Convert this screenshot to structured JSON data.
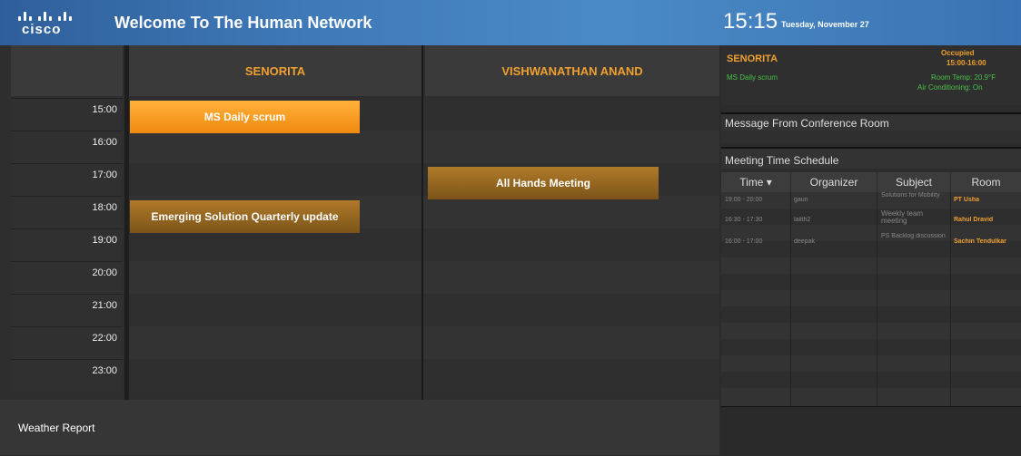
{
  "header": {
    "logo_text": "cisco",
    "title": "Welcome To The Human Network",
    "time": "15:15",
    "date": "Tuesday, November 27"
  },
  "schedule": {
    "rooms": [
      "SENORITA",
      "VISHWANATHAN ANAND"
    ],
    "hours": [
      "15:00",
      "16:00",
      "17:00",
      "18:00",
      "19:00",
      "20:00",
      "21:00",
      "22:00",
      "23:00"
    ],
    "events": [
      {
        "title": "MS Daily scrum",
        "room": "SENORITA",
        "start": "15:00",
        "end": "16:00"
      },
      {
        "title": "All Hands Meeting",
        "room": "VISHWANATHAN ANAND",
        "start": "17:00",
        "end": "18:00"
      },
      {
        "title": "Emerging Solution Quarterly update",
        "room": "SENORITA",
        "start": "18:00",
        "end": "19:00"
      }
    ],
    "weather_label": "Weather Report"
  },
  "status": {
    "room": "SENORITA",
    "state": "Occupied",
    "state_time": "15:00-16:00",
    "current_meeting": "MS Daily scrum",
    "room_temp": "Room Temp: 20.9°F",
    "air_conditioning": "Air Conditioning: On"
  },
  "messages": {
    "heading": "Message From Conference Room"
  },
  "meeting_schedule": {
    "heading": "Meeting Time Schedule",
    "columns": [
      "Time ▾",
      "Organizer",
      "Subject",
      "Room"
    ],
    "rows": [
      {
        "time": "19:00 - 20:00",
        "organizer": "gauri",
        "subject": "Solutions for Mobility",
        "room": "PT Usha"
      },
      {
        "time": "16:30 - 17:30",
        "organizer": "lalith2",
        "subject": "Weekly team meeting",
        "room": "Rahul Dravid"
      },
      {
        "time": "16:00 - 17:00",
        "organizer": "deepak",
        "subject": "PS Backlog discussion",
        "room": "Sachin Tendulkar"
      }
    ]
  },
  "colors": {
    "header_blue": "#3f79b8",
    "event_orange": "#f5a020",
    "event_brown": "#9a6a20",
    "accent_orange": "#f0a030",
    "status_green": "#4ac04a"
  }
}
